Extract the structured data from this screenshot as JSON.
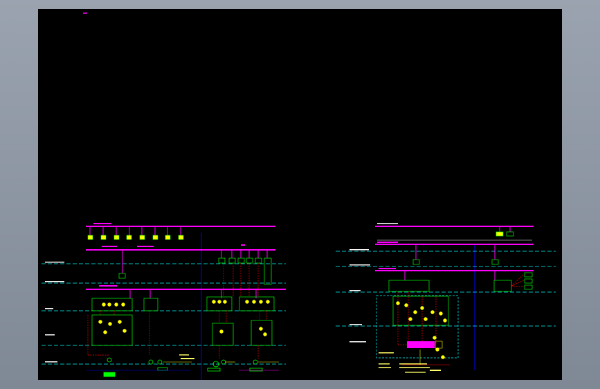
{
  "window": {
    "title": ""
  },
  "colors": {
    "background": "#000000",
    "frame": "#8a93a0",
    "bus": "#ff00ff",
    "level_line": "#00ffff",
    "boundary": "#0000ff",
    "equipment": "#00ff00",
    "signal": "#ff0000",
    "symbol": "#ffff00",
    "text": "#ffffff"
  },
  "icons": {
    "marker": "pink-dash-marker",
    "device": "green-device-box-icon",
    "valve": "yellow-valve-symbol-icon",
    "pump": "yellow-pump-symbol-icon"
  }
}
